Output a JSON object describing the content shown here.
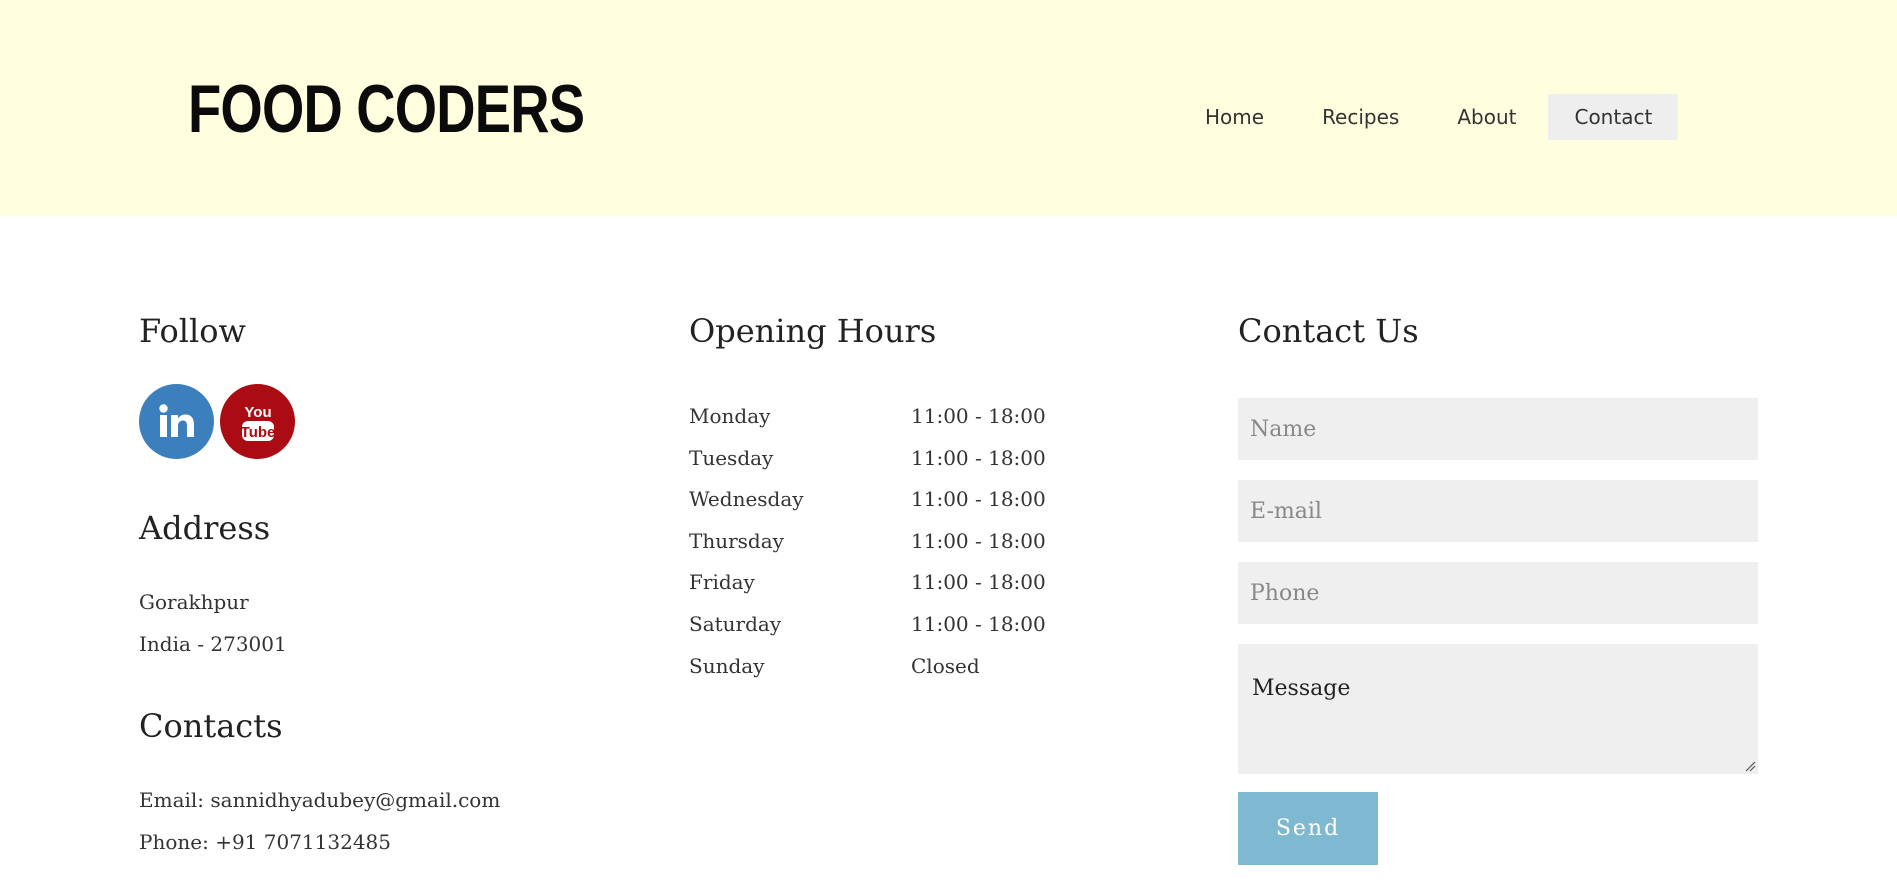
{
  "header": {
    "logo": "FOOD CODERS",
    "nav": [
      {
        "label": "Home"
      },
      {
        "label": "Recipes"
      },
      {
        "label": "About"
      },
      {
        "label": "Contact"
      }
    ],
    "active_nav": "Contact",
    "background_color": "#ffffe0"
  },
  "follow": {
    "title": "Follow",
    "social": [
      {
        "icon": "linkedin-icon",
        "color": "#3b7fbd"
      },
      {
        "icon": "youtube-icon",
        "color": "#ab0b12"
      }
    ]
  },
  "address": {
    "title": "Address",
    "lines": [
      "Gorakhpur",
      "India - 273001"
    ]
  },
  "contacts": {
    "title": "Contacts",
    "email": "Email: sannidhyadubey@gmail.com",
    "phone": "Phone: +91 7071132485"
  },
  "hours": {
    "title": "Opening Hours",
    "rows": [
      {
        "day": "Monday",
        "time": "11:00 - 18:00"
      },
      {
        "day": "Tuesday",
        "time": "11:00 - 18:00"
      },
      {
        "day": "Wednesday",
        "time": "11:00 - 18:00"
      },
      {
        "day": "Thursday",
        "time": "11:00 - 18:00"
      },
      {
        "day": "Friday",
        "time": "11:00 - 18:00"
      },
      {
        "day": "Saturday",
        "time": "11:00 - 18:00"
      },
      {
        "day": "Sunday",
        "time": "Closed"
      }
    ]
  },
  "contact_form": {
    "title": "Contact Us",
    "name_placeholder": "Name",
    "email_placeholder": "E-mail",
    "phone_placeholder": "Phone",
    "message_placeholder": "Message",
    "send_label": "Send",
    "send_color": "#7fb9d1"
  }
}
